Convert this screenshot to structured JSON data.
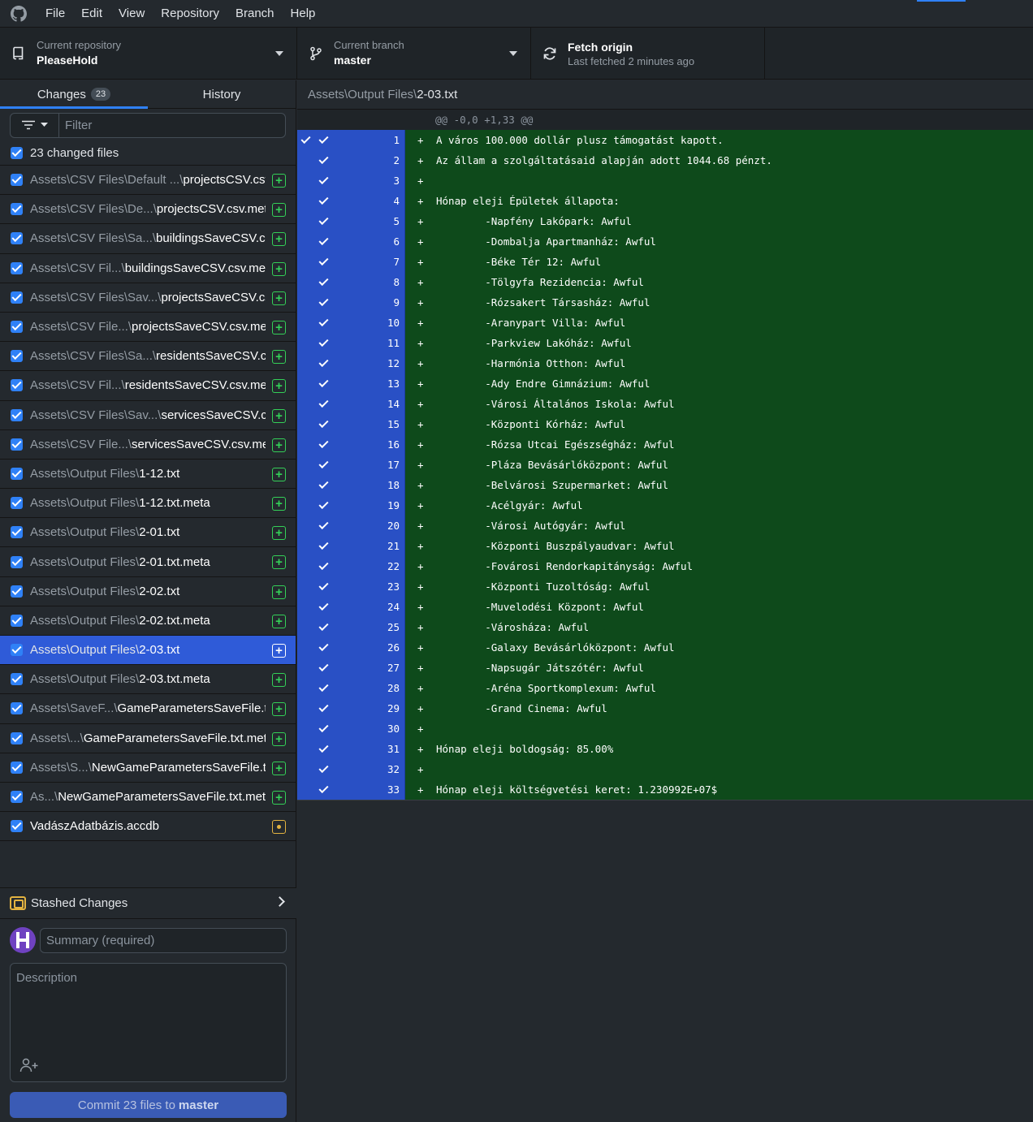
{
  "menubar": {
    "items": [
      "File",
      "Edit",
      "View",
      "Repository",
      "Branch",
      "Help"
    ]
  },
  "toolbar": {
    "repo_label": "Current repository",
    "repo_value": "PleaseHold",
    "branch_label": "Current branch",
    "branch_value": "master",
    "fetch_label": "Fetch origin",
    "fetch_sub": "Last fetched 2 minutes ago"
  },
  "tabs": {
    "changes": "Changes",
    "changes_count": "23",
    "history": "History"
  },
  "filter": {
    "placeholder": "Filter"
  },
  "select_all_label": "23 changed files",
  "files": [
    {
      "dir": "Assets\\CSV Files\\Default ...\\",
      "name": "projectsCSV.csv",
      "status": "added"
    },
    {
      "dir": "Assets\\CSV Files\\De...\\",
      "name": "projectsCSV.csv.meta",
      "status": "added"
    },
    {
      "dir": "Assets\\CSV Files\\Sa...\\",
      "name": "buildingsSaveCSV.csv",
      "status": "added"
    },
    {
      "dir": "Assets\\CSV Fil...\\",
      "name": "buildingsSaveCSV.csv.meta",
      "status": "added"
    },
    {
      "dir": "Assets\\CSV Files\\Sav...\\",
      "name": "projectsSaveCSV.csv",
      "status": "added"
    },
    {
      "dir": "Assets\\CSV File...\\",
      "name": "projectsSaveCSV.csv.meta",
      "status": "added"
    },
    {
      "dir": "Assets\\CSV Files\\Sa...\\",
      "name": "residentsSaveCSV.csv",
      "status": "added"
    },
    {
      "dir": "Assets\\CSV Fil...\\",
      "name": "residentsSaveCSV.csv.meta",
      "status": "added"
    },
    {
      "dir": "Assets\\CSV Files\\Sav...\\",
      "name": "servicesSaveCSV.csv",
      "status": "added"
    },
    {
      "dir": "Assets\\CSV File...\\",
      "name": "servicesSaveCSV.csv.meta",
      "status": "added"
    },
    {
      "dir": "Assets\\Output Files\\",
      "name": "1-12.txt",
      "status": "added"
    },
    {
      "dir": "Assets\\Output Files\\",
      "name": "1-12.txt.meta",
      "status": "added"
    },
    {
      "dir": "Assets\\Output Files\\",
      "name": "2-01.txt",
      "status": "added"
    },
    {
      "dir": "Assets\\Output Files\\",
      "name": "2-01.txt.meta",
      "status": "added"
    },
    {
      "dir": "Assets\\Output Files\\",
      "name": "2-02.txt",
      "status": "added"
    },
    {
      "dir": "Assets\\Output Files\\",
      "name": "2-02.txt.meta",
      "status": "added"
    },
    {
      "dir": "Assets\\Output Files\\",
      "name": "2-03.txt",
      "status": "added",
      "selected": true
    },
    {
      "dir": "Assets\\Output Files\\",
      "name": "2-03.txt.meta",
      "status": "added"
    },
    {
      "dir": "Assets\\SaveF...\\",
      "name": "GameParametersSaveFile.txt",
      "status": "added"
    },
    {
      "dir": "Assets\\...\\",
      "name": "GameParametersSaveFile.txt.meta",
      "status": "added"
    },
    {
      "dir": "Assets\\S...\\",
      "name": "NewGameParametersSaveFile.txt",
      "status": "added"
    },
    {
      "dir": "As...\\",
      "name": "NewGameParametersSaveFile.txt.meta",
      "status": "added"
    },
    {
      "dir": "",
      "name": "VadászAdatbázis.accdb",
      "status": "modified"
    }
  ],
  "stash": {
    "label": "Stashed Changes"
  },
  "commit": {
    "summary_placeholder": "Summary (required)",
    "description_placeholder": "Description",
    "button_prefix": "Commit 23 files to",
    "button_branch": "master"
  },
  "diff": {
    "path_dir": "Assets\\Output Files\\",
    "path_name": "2-03.txt",
    "hunk_header": "@@ -0,0 +1,33 @@",
    "lines": [
      "A város 100.000 dollár plusz támogatást kapott.",
      "Az állam a szolgáltatásaid alapján adott 1044.68 pénzt.",
      "",
      "Hónap eleji Épületek állapota:",
      "\t-Napfény Lakópark: Awful",
      "\t-Dombalja Apartmanház: Awful",
      "\t-Béke Tér 12: Awful",
      "\t-Tölgyfa Rezidencia: Awful",
      "\t-Rózsakert Társasház: Awful",
      "\t-Aranypart Villa: Awful",
      "\t-Parkview Lakóház: Awful",
      "\t-Harmónia Otthon: Awful",
      "\t-Ady Endre Gimnázium: Awful",
      "\t-Városi Általános Iskola: Awful",
      "\t-Központi Kórház: Awful",
      "\t-Rózsa Utcai Egészségház: Awful",
      "\t-Pláza Bevásárlóközpont: Awful",
      "\t-Belvárosi Szupermarket: Awful",
      "\t-Acélgyár: Awful",
      "\t-Városi Autógyár: Awful",
      "\t-Központi Buszpályaudvar: Awful",
      "\t-Fovárosi Rendorkapitányság: Awful",
      "\t-Központi Tuzoltóság: Awful",
      "\t-Muvelodési Központ: Awful",
      "\t-Városháza: Awful",
      "\t-Galaxy Bevásárlóközpont: Awful",
      "\t-Napsugár Játszótér: Awful",
      "\t-Aréna Sportkomplexum: Awful",
      "\t-Grand Cinema: Awful",
      "",
      "Hónap eleji boldogság: 85.00%",
      "",
      "Hónap eleji költségvetési keret: 1.230992E+07$"
    ]
  }
}
